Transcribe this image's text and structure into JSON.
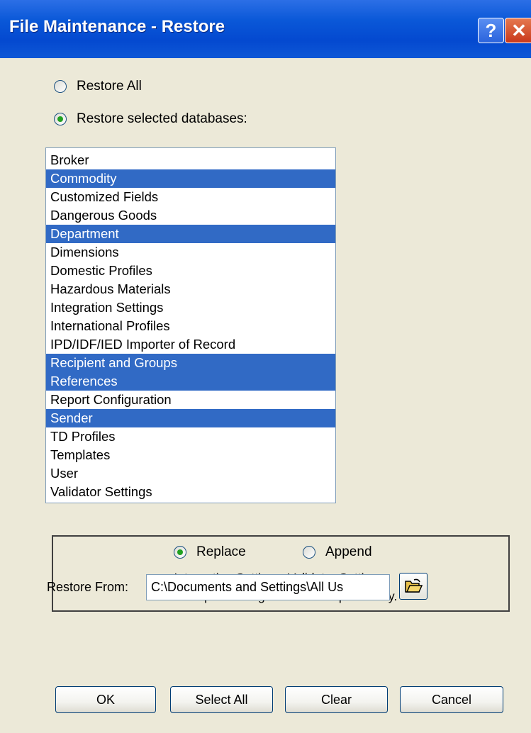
{
  "window": {
    "title": "File Maintenance - Restore",
    "help_label": "?",
    "close_label": "✕"
  },
  "mode": {
    "restore_all_label": "Restore All",
    "restore_selected_label": "Restore selected databases:",
    "selected": "restore_selected"
  },
  "databases": [
    {
      "label": "Broker",
      "selected": false
    },
    {
      "label": "Commodity",
      "selected": true
    },
    {
      "label": "Customized Fields",
      "selected": false
    },
    {
      "label": "Dangerous Goods",
      "selected": false
    },
    {
      "label": "Department",
      "selected": true
    },
    {
      "label": "Dimensions",
      "selected": false
    },
    {
      "label": "Domestic Profiles",
      "selected": false
    },
    {
      "label": "Hazardous Materials",
      "selected": false
    },
    {
      "label": "Integration Settings",
      "selected": false
    },
    {
      "label": "International Profiles",
      "selected": false
    },
    {
      "label": "IPD/IDF/IED Importer of Record",
      "selected": false
    },
    {
      "label": "Recipient and Groups",
      "selected": true
    },
    {
      "label": "References",
      "selected": true
    },
    {
      "label": "Report Configuration",
      "selected": false
    },
    {
      "label": "Sender",
      "selected": true
    },
    {
      "label": "TD Profiles",
      "selected": false
    },
    {
      "label": "Templates",
      "selected": false
    },
    {
      "label": "User",
      "selected": false
    },
    {
      "label": "Validator Settings",
      "selected": false
    }
  ],
  "restore_type": {
    "replace_label": "Replace",
    "append_label": "Append",
    "selected": "replace",
    "note_line1": "Integration Settings, Validator Settings,",
    "note_line2": "and Report Configuration are replace only."
  },
  "restore_from": {
    "label": "Restore From:",
    "value": "C:\\Documents and Settings\\All Us",
    "browse_icon": "folder-open-icon"
  },
  "buttons": {
    "ok": "OK",
    "select_all": "Select All",
    "clear": "Clear",
    "cancel": "Cancel"
  },
  "colors": {
    "titlebar": "#0a58d8",
    "selection": "#316ac5",
    "dialog_bg": "#ece9d8",
    "radio_dot": "#21a121"
  }
}
